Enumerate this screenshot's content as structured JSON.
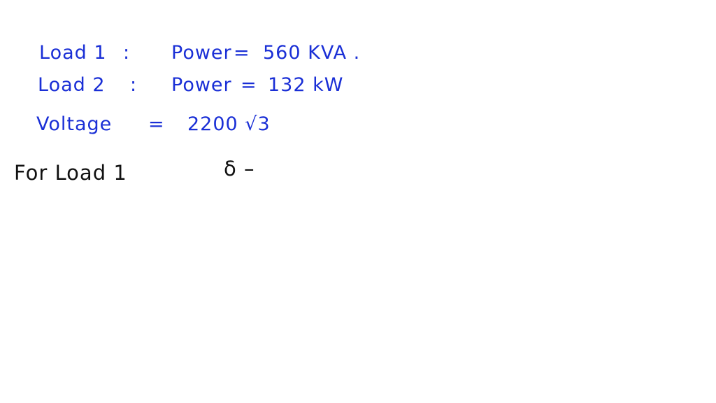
{
  "notes": {
    "load1": {
      "label": "Load 1",
      "sep": ":",
      "name": "Power",
      "eq": "=",
      "value": "560 KVA ."
    },
    "load2": {
      "label": "Load 2",
      "sep": ":",
      "name": "Power",
      "eq": "=",
      "value": "132 kW"
    },
    "voltage": {
      "label": "Voltage",
      "eq": "=",
      "value": "2200 √3"
    },
    "for_load": {
      "label": "For Load 1",
      "symbol": "δ –"
    }
  },
  "colors": {
    "ink_blue": "#1a2fd6",
    "ink_black": "#111111"
  }
}
